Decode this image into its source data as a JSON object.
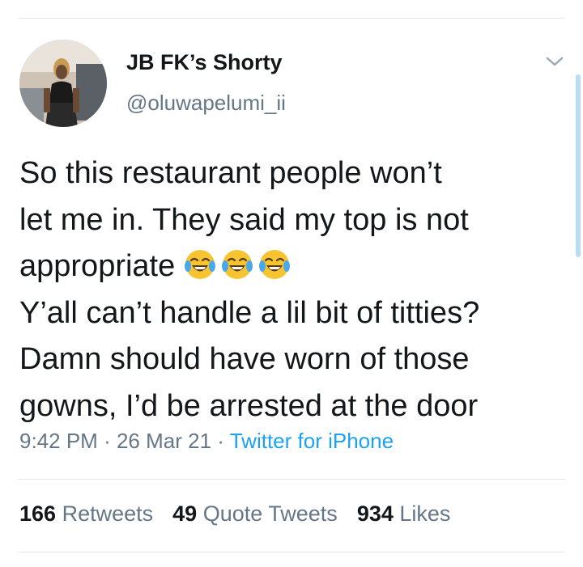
{
  "user": {
    "display_name": "JB FK’s Shorty",
    "handle": "@oluwapelumi_ii"
  },
  "tweet": {
    "lines": [
      "So this restaurant people won’t",
      "let me in. They said my top is not",
      "appropriate",
      "Y’all can’t handle a lil bit of titties?",
      "Damn should have worn of those",
      "gowns, I’d be arrested at the door"
    ],
    "emoji": "face-with-tears-of-joy"
  },
  "meta": {
    "time": "9:42 PM",
    "sep1": "·",
    "date": "26 Mar 21",
    "sep2": "·",
    "source": "Twitter for iPhone"
  },
  "stats": {
    "retweets_count": "166",
    "retweets_label": "Retweets",
    "quotes_count": "49",
    "quotes_label": "Quote Tweets",
    "likes_count": "934",
    "likes_label": "Likes"
  },
  "colors": {
    "text": "#14171a",
    "secondary": "#657786",
    "link": "#1da1f2",
    "divider": "#e1e8ed"
  }
}
